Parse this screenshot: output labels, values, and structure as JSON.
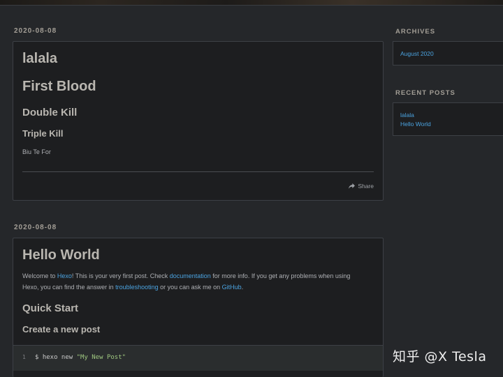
{
  "posts": [
    {
      "date": "2020-08-08",
      "title": "lalala",
      "h1": "First Blood",
      "h2": "Double Kill",
      "h3": "Triple Kill",
      "text": "Biu Te For",
      "share_label": "Share"
    },
    {
      "date": "2020-08-08",
      "title": "Hello World",
      "intro": {
        "p1": "Welcome to ",
        "hexo_link": "Hexo",
        "p2": "! This is your very first post. Check ",
        "docs_link": "documentation",
        "p3": " for more info. If you get any problems when using",
        "p4": "Hexo, you can find the answer in ",
        "troubleshooting_link": "troubleshooting",
        "p5": " or you can ask me on ",
        "github_link": "GitHub",
        "p6": "."
      },
      "quick_start": "Quick Start",
      "create_post": "Create a new post",
      "code": {
        "line_number": "1",
        "command": "$ hexo new ",
        "argument": "\"My New Post\""
      }
    }
  ],
  "sidebar": {
    "archives_title": "ARCHIVES",
    "archives": [
      "August 2020"
    ],
    "recent_title": "RECENT POSTS",
    "recent": [
      "lalala",
      "Hello World"
    ]
  },
  "watermark": "知乎 @X Tesla",
  "icons": {
    "share": "share-icon"
  }
}
